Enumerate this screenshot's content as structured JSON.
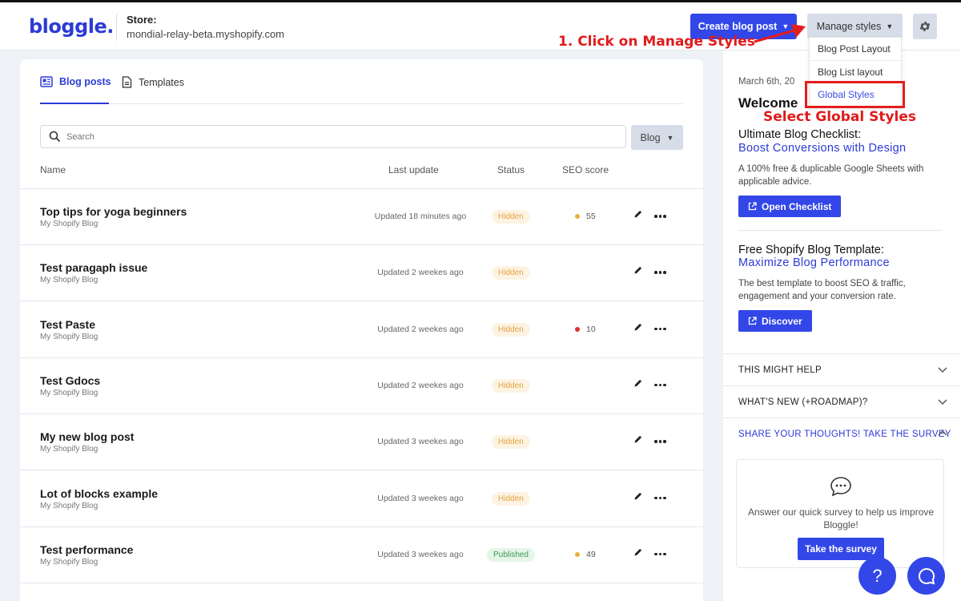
{
  "header": {
    "logo": "bloggle.",
    "store_label": "Store:",
    "store_url": "mondial-relay-beta.myshopify.com",
    "create_label": "Create blog post",
    "manage_label": "Manage styles",
    "settings_icon": "gear-icon"
  },
  "dropdown": {
    "items": [
      "Blog Post Layout",
      "Blog List layout",
      "Global Styles"
    ],
    "active_index": 2
  },
  "annotations": {
    "step1": "1. Click on Manage Styles",
    "step2": "Select Global Styles",
    "color": "#e41d1d"
  },
  "tabs": {
    "posts": "Blog posts",
    "templates": "Templates"
  },
  "search": {
    "placeholder": "Search",
    "filter_label": "Blog"
  },
  "columns": {
    "name": "Name",
    "last_update": "Last update",
    "status": "Status",
    "seo": "SEO score"
  },
  "rows": [
    {
      "title": "Top tips for yoga beginners",
      "blog": "My Shopify Blog",
      "updated": "Updated 18 minutes ago",
      "status": "Hidden",
      "seo": "55",
      "seo_color": "#e8b23a"
    },
    {
      "title": "Test paragaph issue",
      "blog": "My Shopify Blog",
      "updated": "Updated 2 weekes ago",
      "status": "Hidden",
      "seo": "",
      "seo_color": ""
    },
    {
      "title": "Test Paste",
      "blog": "My Shopify Blog",
      "updated": "Updated 2 weekes ago",
      "status": "Hidden",
      "seo": "10",
      "seo_color": "#e0302f"
    },
    {
      "title": "Test Gdocs",
      "blog": "My Shopify Blog",
      "updated": "Updated 2 weekes ago",
      "status": "Hidden",
      "seo": "",
      "seo_color": ""
    },
    {
      "title": "My new blog post",
      "blog": "My Shopify Blog",
      "updated": "Updated 3 weekes ago",
      "status": "Hidden",
      "seo": "",
      "seo_color": ""
    },
    {
      "title": "Lot of blocks example",
      "blog": "My Shopify Blog",
      "updated": "Updated 3 weekes ago",
      "status": "Hidden",
      "seo": "",
      "seo_color": ""
    },
    {
      "title": "Test performance",
      "blog": "My Shopify Blog",
      "updated": "Updated 3 weekes ago",
      "status": "Published",
      "seo": "49",
      "seo_color": "#e8b23a"
    }
  ],
  "side": {
    "date": "March 6th, 20",
    "welcome": "Welcome",
    "checklist_title": "Ultimate Blog Checklist:",
    "checklist_sub": "Boost Conversions with Design",
    "checklist_text": "A 100% free & duplicable Google Sheets with applicable advice.",
    "checklist_btn": "Open Checklist",
    "template_title": "Free Shopify Blog Template:",
    "template_sub": "Maximize Blog Performance",
    "template_text": "The best template to boost SEO & traffic, engagement and your conversion rate.",
    "template_btn": "Discover",
    "acc_help": "THIS MIGHT HELP",
    "acc_new": "WHAT'S NEW (+ROADMAP)?",
    "acc_survey": "SHARE YOUR THOUGHTS! TAKE THE SURVEY",
    "survey_text": "Answer our quick survey to help us improve Bloggle!",
    "survey_btn": "Take the survey"
  },
  "fab": {
    "help": "?"
  },
  "colors": {
    "primary": "#3347e8",
    "brand": "#2c3bd6",
    "hidden_badge": "#e3a33b",
    "published_badge": "#3c9a55"
  }
}
